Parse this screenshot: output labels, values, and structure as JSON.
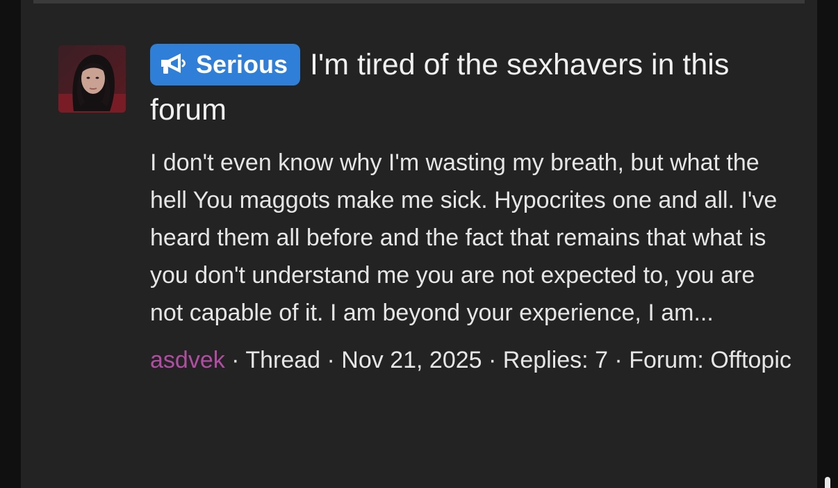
{
  "thread": {
    "prefix_badge": "Serious",
    "prefix_icon": "megaphone-icon",
    "title": "I'm tired of the sexhavers in this forum",
    "excerpt": "I don't even know why I'm wasting my breath, but what the hell You maggots make me sick. Hypocrites one and all. I've heard them all before and the fact that remains that what is you don't understand me you are not expected to, you are not capable of it. I am beyond your experience, I am...",
    "author": "asdvek",
    "separator": " · ",
    "type": "Thread",
    "date": "Nov 21, 2025",
    "replies": "Replies: 7",
    "forum": "Forum: Offtopic"
  },
  "colors": {
    "badge_bg": "#2f7ed8",
    "username": "#b14ea3",
    "panel_bg": "#232323"
  }
}
